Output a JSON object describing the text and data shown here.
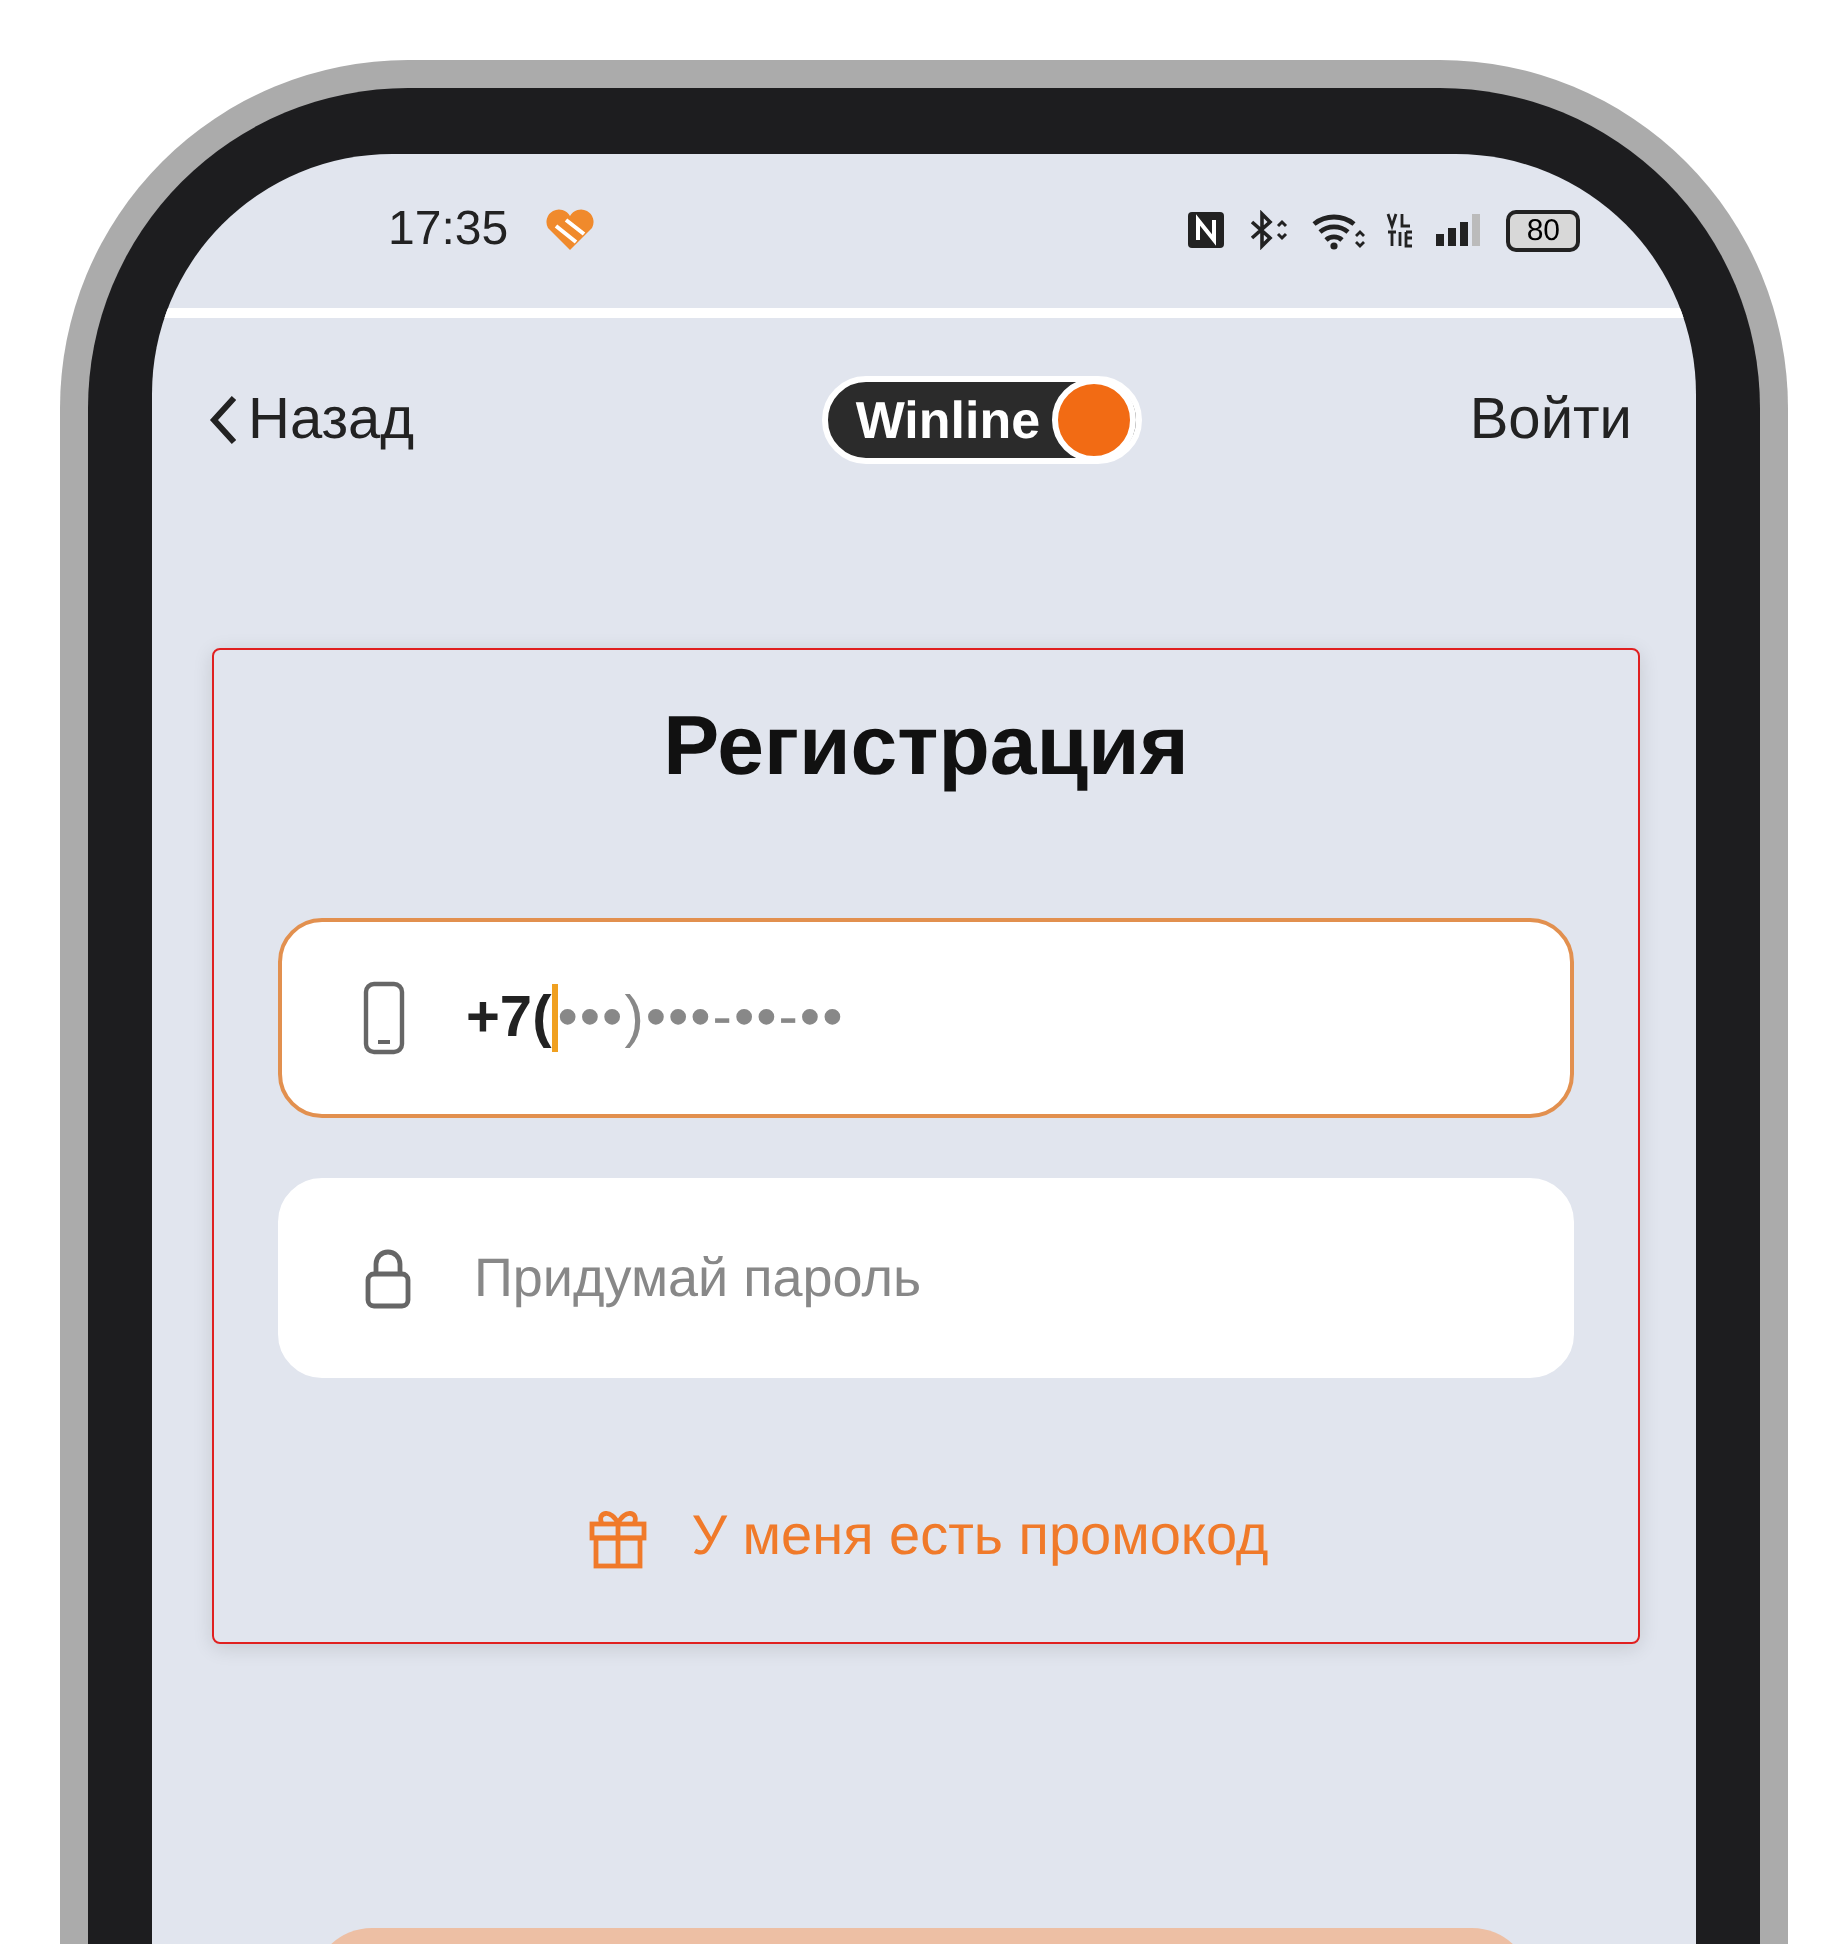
{
  "status_bar": {
    "time": "17:35",
    "battery": "80"
  },
  "nav": {
    "back": "Назад",
    "logo": "Winline",
    "login": "Войти"
  },
  "form": {
    "title": "Регистрация",
    "fields": [
      {
        "kind": "phone",
        "value": "+7(",
        "mask": "•••)•••-••-••",
        "focused": true
      },
      {
        "kind": "password",
        "placeholder": "Придумай пароль",
        "focused": false
      }
    ],
    "promo_link": "У меня есть промокод"
  }
}
